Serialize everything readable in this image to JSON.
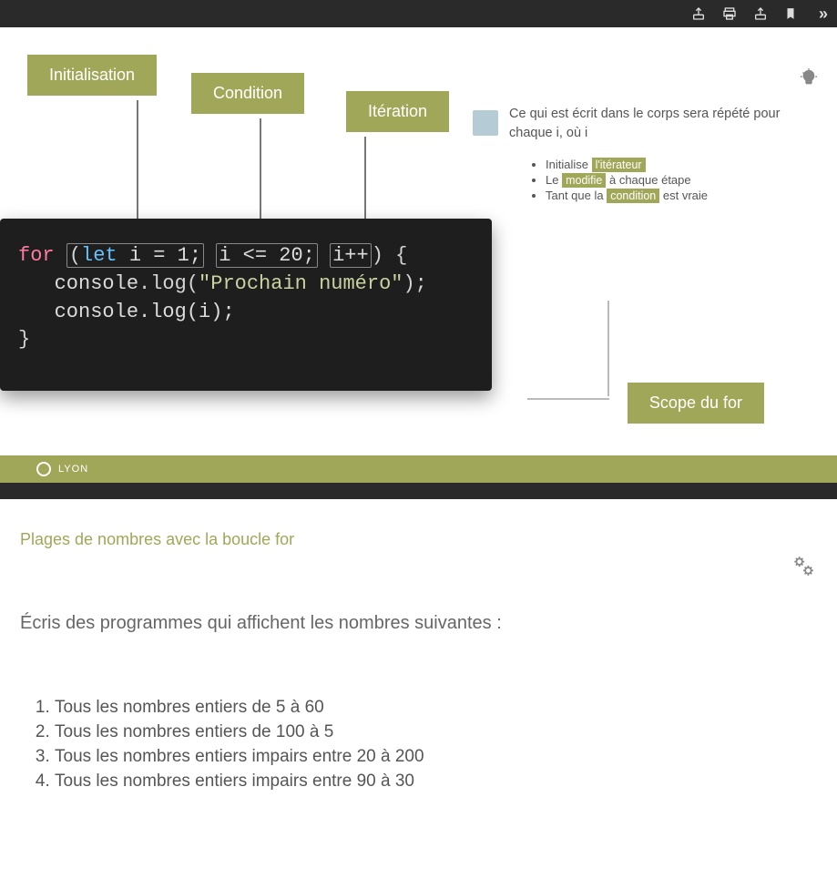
{
  "toolbar": {
    "icons": [
      "share-icon",
      "print-icon",
      "share-icon-2",
      "bookmark-icon",
      "more-icon"
    ]
  },
  "slide1": {
    "tags": {
      "init": "Initialisation",
      "cond": "Condition",
      "iter": "Itération",
      "scope": "Scope du for"
    },
    "side": {
      "intro": "Ce qui est écrit dans le corps sera répété pour chaque i, où i",
      "bullets": [
        {
          "pre": "Initialise ",
          "hl": "l'itérateur",
          "post": ""
        },
        {
          "pre": "Le ",
          "hl": "modifie",
          "post": " à chaque étape"
        },
        {
          "pre": "Tant que la ",
          "hl": "condition",
          "post": " est vraie"
        }
      ]
    },
    "code": {
      "for": "for",
      "let": "let",
      "init": "i = 1;",
      "cond": "i <= 20;",
      "iter": "i++",
      "open": ") {",
      "l2a": "console",
      "l2b": ".log(",
      "l2str": "\"Prochain numéro\"",
      "l2c": ");",
      "l3": "console.log(i);",
      "l4": "}"
    },
    "footer": "LYON"
  },
  "slide2": {
    "subhead": "Plages de nombres avec la boucle for",
    "instruction": "Écris des programmes qui affichent les nombres suivantes :",
    "items": [
      "Tous les nombres entiers de 5 à 60",
      "Tous les nombres entiers de 100 à 5",
      "Tous les nombres entiers impairs entre 20 à 200",
      "Tous les nombres entiers impairs entre 90 à 30"
    ]
  }
}
